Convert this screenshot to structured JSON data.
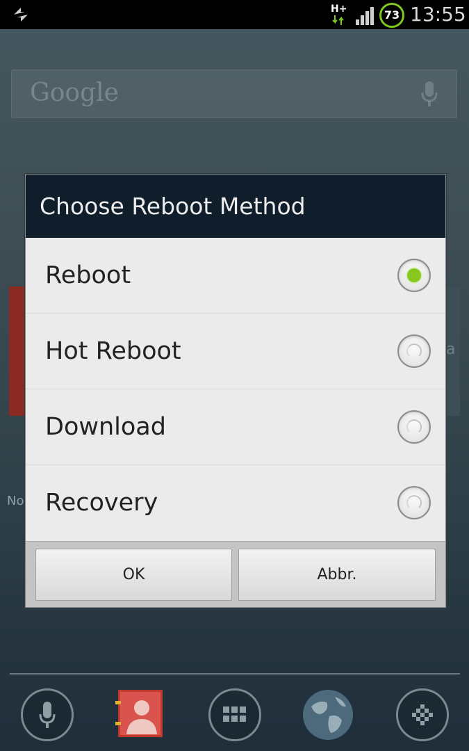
{
  "status_bar": {
    "network_type": "H+",
    "battery_level": "73",
    "time": "13:55",
    "icons": [
      "sync-icon",
      "network-type-icon",
      "signal-icon",
      "battery-icon"
    ],
    "battery_color": "#7ec820"
  },
  "home": {
    "search_logo": "Google",
    "widget_left_fragment": "No",
    "widget_right_fragment": "a",
    "dock": [
      "mic-icon",
      "contacts-icon",
      "apps-icon",
      "globe-icon",
      "grid-icon"
    ]
  },
  "dialog": {
    "title": "Choose Reboot Method",
    "options": [
      {
        "label": "Reboot",
        "selected": true
      },
      {
        "label": "Hot Reboot",
        "selected": false
      },
      {
        "label": "Download",
        "selected": false
      },
      {
        "label": "Recovery",
        "selected": false
      }
    ],
    "ok_label": "OK",
    "cancel_label": "Abbr.",
    "accent_color": "#86c820",
    "header_color": "#0f1e2a"
  }
}
